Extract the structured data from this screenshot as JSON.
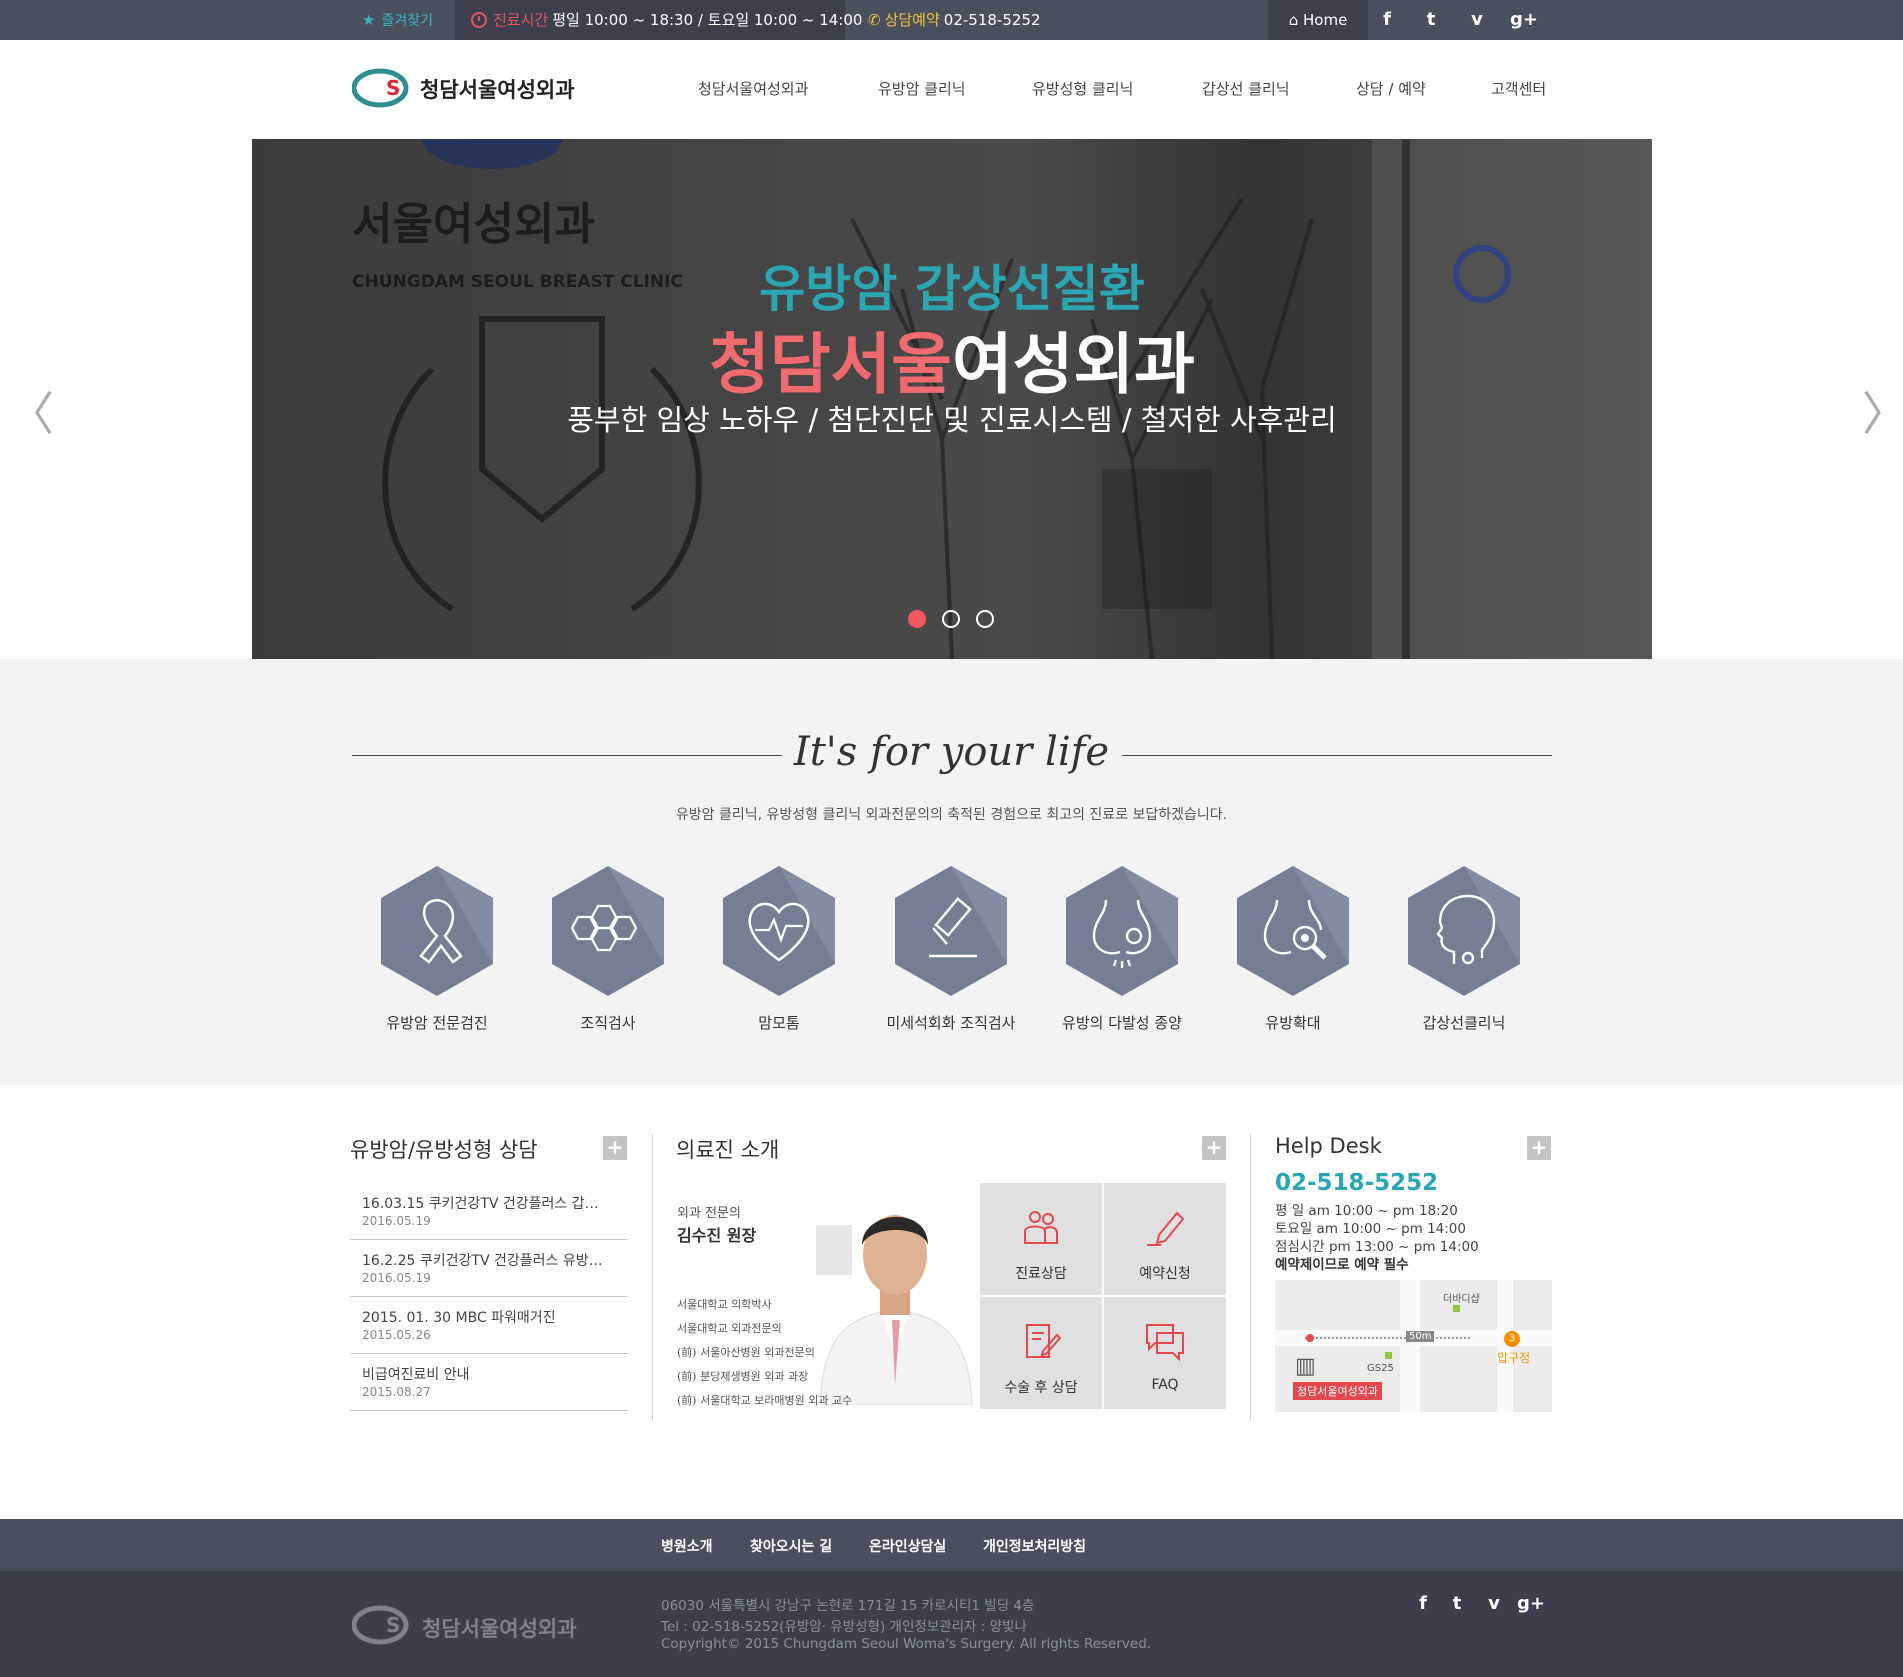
{
  "topbar": {
    "favorite": "즐겨찾기",
    "hours_label": "진료시간",
    "hours_text": "평일 10:00 ~ 18:30 / 토요일 10:00 ~ 14:00",
    "phone_label": "상담예약",
    "phone_number": "02-518-5252",
    "home": "Home",
    "social": [
      "f",
      "t",
      "v",
      "g+"
    ]
  },
  "header": {
    "logo_text": "청담서울여성외과",
    "nav": [
      "청담서울여성외과",
      "유방암 클리닉",
      "유방성형 클리닉",
      "갑상선 클리닉",
      "상담 / 예약",
      "고객센터"
    ]
  },
  "hero": {
    "line1": "유방암 갑상선질환",
    "line2_pink": "청담서울",
    "line2_white": "여성외과",
    "line3": "풍부한 임상 노하우 / 첨단진단 및 진료시스템 / 철저한 사후관리",
    "slides": 3,
    "active_slide": 1
  },
  "life": {
    "title": "It's for your life",
    "subtitle": "유방암 클리닉, 유방성형 클리닉 외과전문의의 축적된 경험으로 최고의 진료로 보답하겠습니다.",
    "clinics": [
      {
        "label": "유방암 전문검진",
        "icon": "ribbon-icon"
      },
      {
        "label": "조직검사",
        "icon": "cells-icon"
      },
      {
        "label": "맘모톰",
        "icon": "heart-pulse-icon"
      },
      {
        "label": "미세석회화 조직검사",
        "icon": "microscope-icon"
      },
      {
        "label": "유방의 다발성 종양",
        "icon": "breast-icon"
      },
      {
        "label": "유방확대",
        "icon": "breast-search-icon"
      },
      {
        "label": "갑상선클리닉",
        "icon": "thyroid-profile-icon"
      }
    ],
    "hex_color": "#777d93"
  },
  "consult": {
    "title": "유방암/유방성형 상담",
    "items": [
      {
        "title": "16.03.15 쿠키건강TV 건강플러스 갑…",
        "date": "2016.05.19"
      },
      {
        "title": "16.2.25 쿠키건강TV 건강플러스 유방…",
        "date": "2016.05.19"
      },
      {
        "title": "2015. 01. 30 MBC 파워매거진",
        "date": "2015.05.26"
      },
      {
        "title": "비급여진료비 안내",
        "date": "2015.08.27"
      }
    ]
  },
  "doctors": {
    "title": "의료진 소개",
    "role": "외과 전문의",
    "name": "김수진 원장",
    "credentials": [
      "서울대학교 의학박사",
      "서울대학교 외과전문의",
      "(前) 서울아산병원 외과전문의",
      "(前) 분당제생병원 외과 과장",
      "(前) 서울대학교 보라매병원 외과 교수"
    ],
    "tiles": [
      "진료상담",
      "예약신청",
      "수술 후 상담",
      "FAQ"
    ]
  },
  "helpdesk": {
    "title": "Help Desk",
    "phone": "02-518-5252",
    "lines": [
      "평 일   am 10:00 ~ pm 18:20",
      "토요일   am 10:00 ~ pm 14:00",
      "점심시간   pm 13:00 ~ pm 14:00"
    ],
    "note": "예약제이므로 예약 필수",
    "map": {
      "label_top": "더바디샵",
      "distance": "50m",
      "station": "압구정",
      "station_num": "3",
      "store": "GS25",
      "clinic": "청담서울여성외과"
    }
  },
  "footer": {
    "nav": [
      "병원소개",
      "찾아오시는 길",
      "온라인상담실",
      "개인정보처리방침"
    ],
    "logo_text": "청담서울여성외과",
    "address": "06030 서울특별시 강남구 논현로 171길 15 카로시티1 빌딩 4층",
    "tel": "Tel : 02-518-5252(유방암· 유방성형)      개인정보관리자 : 양빛나",
    "copyright": "Copyright© 2015 Chungdam Seoul Woma's Surgery. All rights Reserved.",
    "social": [
      "f",
      "t",
      "v",
      "g+"
    ]
  }
}
